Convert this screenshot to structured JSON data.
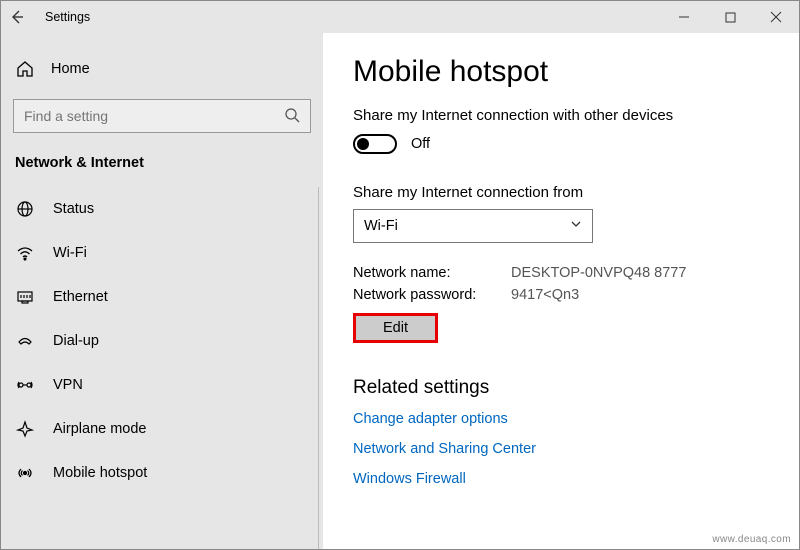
{
  "window": {
    "title": "Settings"
  },
  "sidebar": {
    "home": "Home",
    "search_placeholder": "Find a setting",
    "category": "Network & Internet",
    "items": [
      {
        "label": "Status"
      },
      {
        "label": "Wi-Fi"
      },
      {
        "label": "Ethernet"
      },
      {
        "label": "Dial-up"
      },
      {
        "label": "VPN"
      },
      {
        "label": "Airplane mode"
      },
      {
        "label": "Mobile hotspot"
      }
    ]
  },
  "main": {
    "title": "Mobile hotspot",
    "share_heading": "Share my Internet connection with other devices",
    "toggle_state": "Off",
    "share_from_label": "Share my Internet connection from",
    "dropdown_value": "Wi-Fi",
    "network_name_label": "Network name:",
    "network_name_value": "DESKTOP-0NVPQ48 8777",
    "network_password_label": "Network password:",
    "network_password_value": "9417<Qn3",
    "edit_label": "Edit",
    "related_heading": "Related settings",
    "links": [
      "Change adapter options",
      "Network and Sharing Center",
      "Windows Firewall"
    ]
  },
  "watermark": "www.deuaq.com"
}
